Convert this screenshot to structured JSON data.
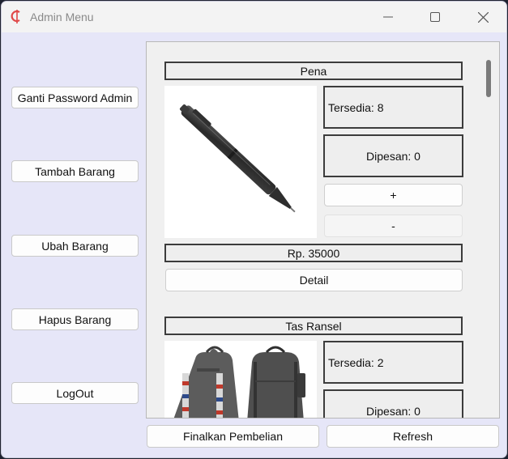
{
  "window": {
    "title": "Admin Menu",
    "icon": "app-logo-icon",
    "controls": [
      "minimize-icon",
      "maximize-icon",
      "close-icon"
    ]
  },
  "sidebar": {
    "buttons": [
      {
        "label": "Ganti Password Admin"
      },
      {
        "label": "Tambah Barang"
      },
      {
        "label": "Ubah Barang"
      },
      {
        "label": "Hapus Barang"
      },
      {
        "label": "LogOut"
      }
    ]
  },
  "products": [
    {
      "name": "Pena",
      "image": "pen-image",
      "stock": "Tersedia: 8",
      "ordered": "Dipesan: 0",
      "plus": "+",
      "minus": "-",
      "price": "Rp. 35000",
      "detail": "Detail"
    },
    {
      "name": "Tas Ransel",
      "image": "backpack-image",
      "stock": "Tersedia: 2",
      "ordered": "Dipesan: 0"
    }
  ],
  "footer": {
    "finalize": "Finalkan Pembelian",
    "refresh": "Refresh"
  },
  "colors": {
    "window_bg": "#e6e6f8",
    "titlebar_bg": "#f3f3f3",
    "icon_red": "#e04848",
    "panel_bg": "#f0f0f0"
  }
}
